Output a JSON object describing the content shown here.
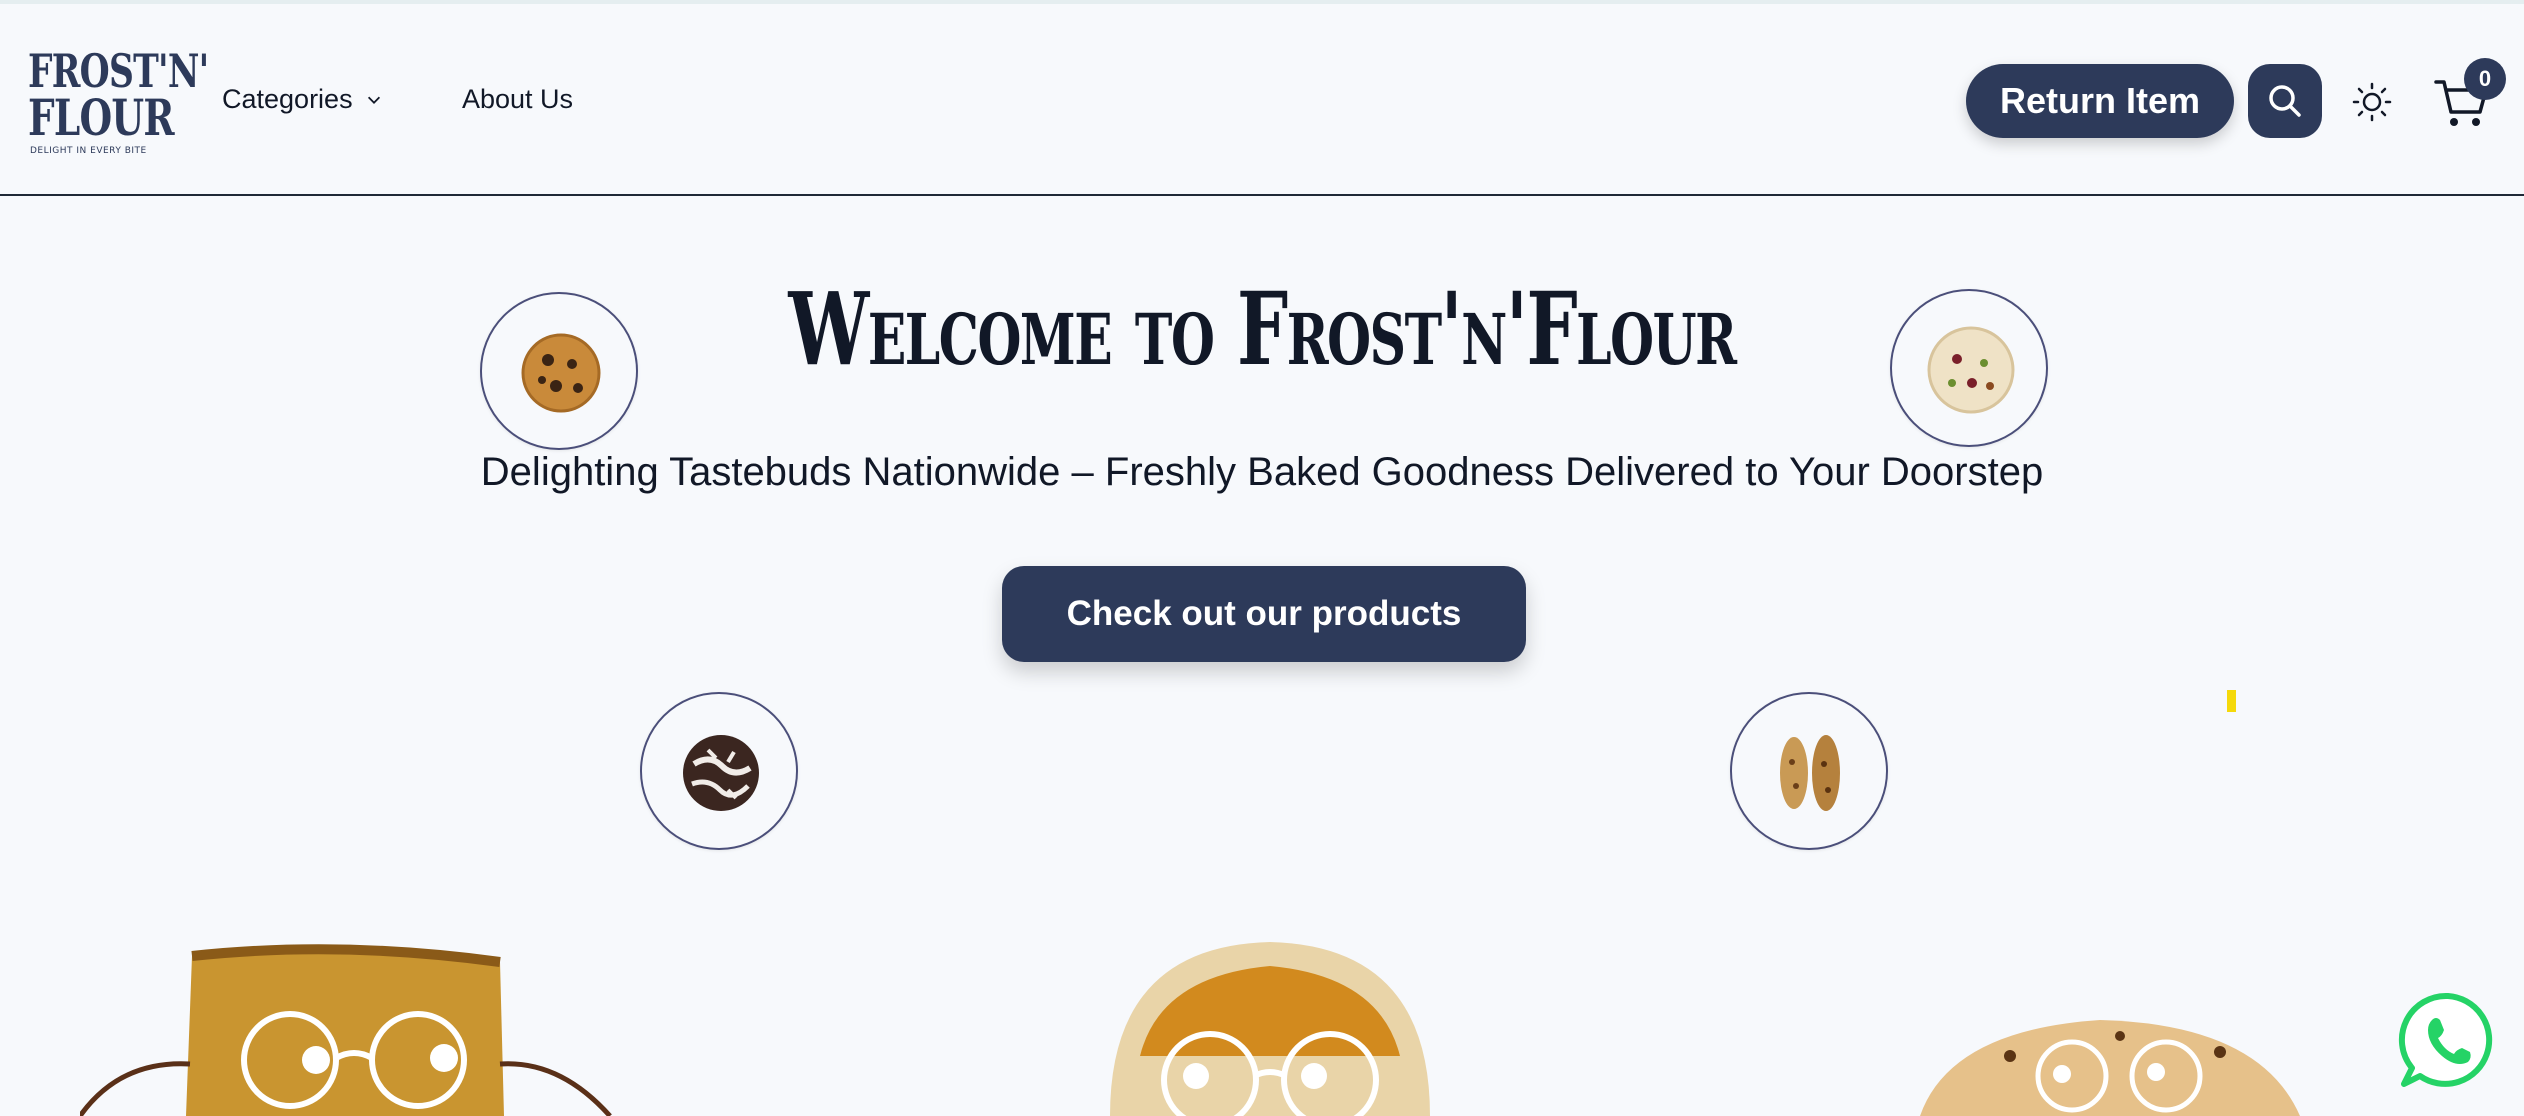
{
  "brand": {
    "logo_line1": "FROST'N'",
    "logo_line2": "FLOUR",
    "tagline": "DELIGHT IN EVERY BITE",
    "primary_color": "#2d3a5a",
    "background_color": "#f7f9fc"
  },
  "nav": {
    "categories_label": "Categories",
    "about_label": "About Us"
  },
  "header_actions": {
    "return_label": "Return Item",
    "search_icon": "search-icon",
    "theme_icon": "sun-icon",
    "cart_icon": "cart-icon",
    "cart_count": "0"
  },
  "hero": {
    "title": "Welcome to Frost'n'Flour",
    "subtitle": "Delighting Tastebuds Nationwide – Freshly Baked Goodness Delivered to Your Doorstep",
    "cta_label": "Check out our products"
  },
  "floating_items": [
    {
      "icon": "chocolate-chip-cookie-icon"
    },
    {
      "icon": "fruit-cookie-icon"
    },
    {
      "icon": "crinkle-cookie-icon"
    },
    {
      "icon": "biscotti-icon"
    }
  ],
  "floating_button": {
    "icon": "whatsapp-icon",
    "color": "#25d366"
  }
}
